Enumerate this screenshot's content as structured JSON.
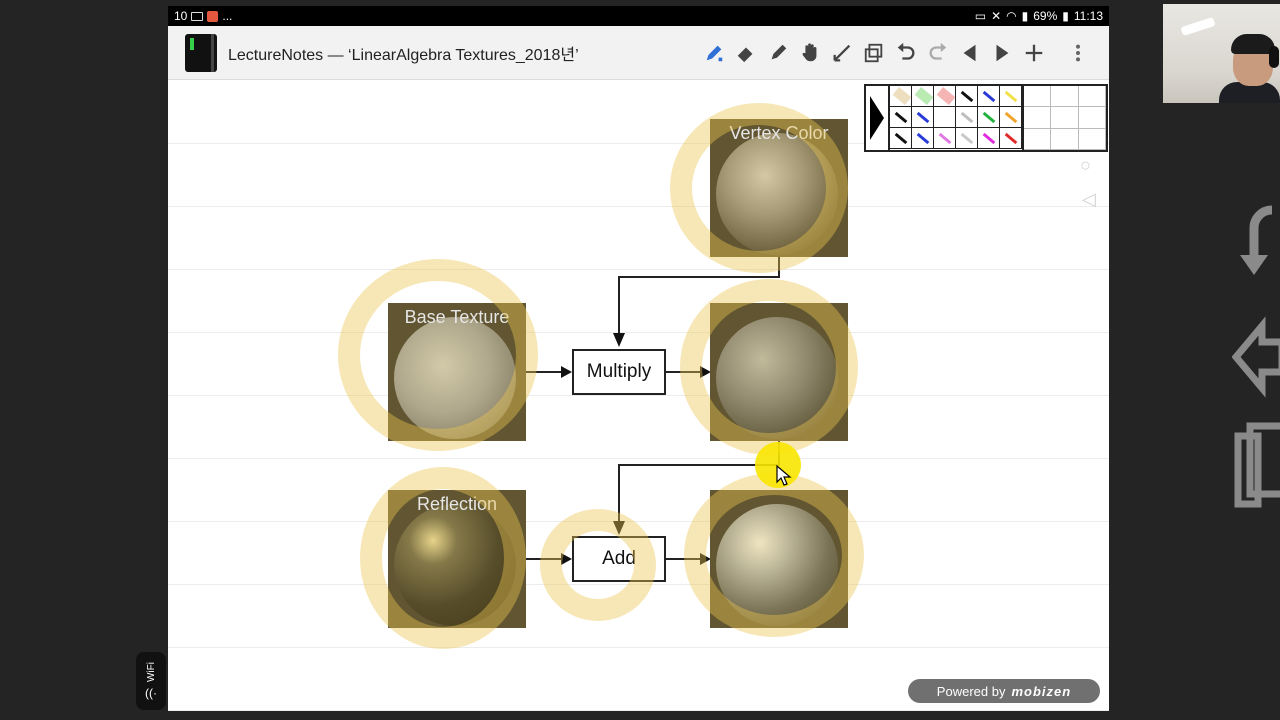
{
  "status_bar": {
    "time_left": "10",
    "dots": "...",
    "battery": "69%",
    "clock": "11:13"
  },
  "app": {
    "title": "LectureNotes — ‘LinearAlgebra Textures_2018년’"
  },
  "toolbar": {
    "tools": [
      "pen-icon",
      "eraser-icon",
      "marker-icon",
      "hand-icon",
      "line-icon",
      "copy-icon",
      "undo-icon",
      "redo-icon",
      "prev-page-icon",
      "next-page-icon",
      "add-page-icon",
      "overflow-menu-icon"
    ]
  },
  "palette": {
    "rows": [
      [
        "#e8d6b0",
        "#a8e6a0",
        "#f4a3a3",
        "#111111",
        "#2a3ad8",
        "#f2e04a"
      ],
      [
        "#111111",
        "#2a3ad8",
        "#ffffff",
        "#bdbdbd",
        "#24b03c",
        "#f2a52a"
      ],
      [
        "#111111",
        "#2a3ad8",
        "#e07ae0",
        "#c8c8c8",
        "#e02adf",
        "#e02a2a"
      ]
    ]
  },
  "diagram": {
    "vertex_color_label": "Vertex Color",
    "base_texture_label": "Base Texture",
    "reflection_label": "Reflection",
    "multiply_label": "Multiply",
    "add_label": "Add"
  },
  "footer": {
    "powered_by": "Powered by",
    "brand": "mobizen"
  },
  "wifi_badge": {
    "label": "WiFi"
  },
  "colors": {
    "highlight": "#ecc650",
    "cursor": "#f8e600",
    "statusbar": "#000000"
  }
}
